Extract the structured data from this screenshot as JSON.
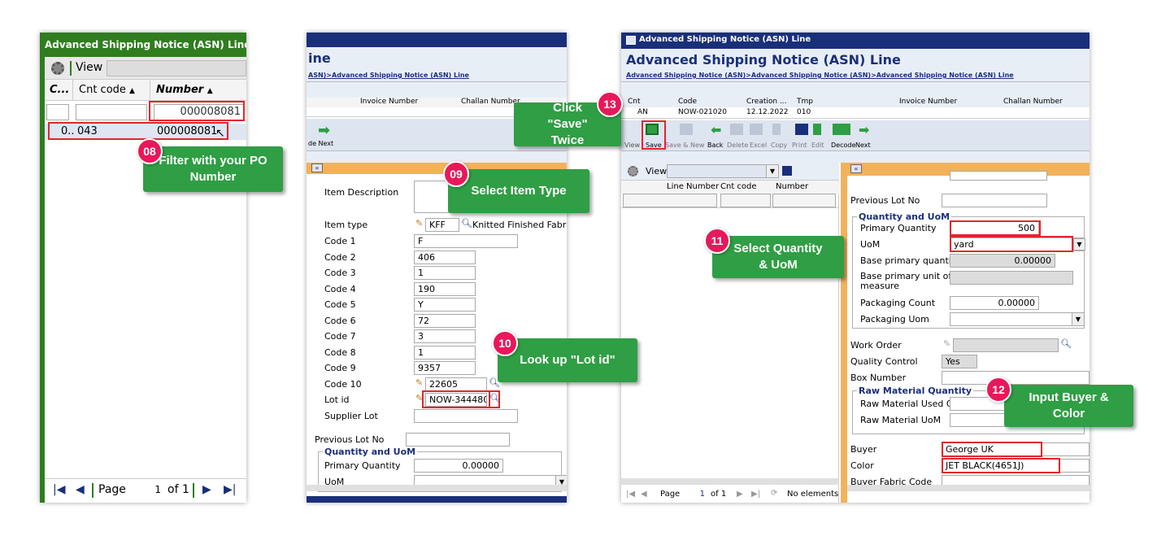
{
  "panel1": {
    "title": "Advanced Shipping Notice (ASN) Line",
    "view_label": "View",
    "col_c": "C...",
    "col_cnt_code": "Cnt code",
    "col_number": "Number",
    "filter_value": "000008081",
    "row": {
      "c": "0..",
      "cnt_code": "043",
      "number": "000008081"
    },
    "page_label": "Page",
    "page_value": "1",
    "page_of": "of 1"
  },
  "panel2": {
    "title_frag": "ine",
    "breadcrumb_frag": "ASN)>Advanced Shipping Notice (ASN) Line",
    "col_invoice": "Invoice Number",
    "col_challan": "Challan Number",
    "toolbar_frag": "de Next",
    "fields": {
      "item_description": "Item Description",
      "item_type": "Item type",
      "item_type_code": "KFF",
      "item_type_name": "Knitted Finished Fabric",
      "code1": "Code 1",
      "code1_v": "F",
      "code2": "Code 2",
      "code2_v": "406",
      "code3": "Code 3",
      "code3_v": "1",
      "code4": "Code 4",
      "code4_v": "190",
      "code5": "Code 5",
      "code5_v": "Y",
      "code6": "Code 6",
      "code6_v": "72",
      "code7": "Code 7",
      "code7_v": "3",
      "code8": "Code 8",
      "code8_v": "1",
      "code9": "Code 9",
      "code9_v": "9357",
      "code10": "Code 10",
      "code10_v": "22605",
      "lot_id": "Lot id",
      "lot_id_v": "NOW-344480",
      "supplier_lot": "Supplier Lot",
      "previous_lot": "Previous Lot No",
      "qty_group": "Quantity and UoM",
      "primary_qty": "Primary Quantity",
      "primary_qty_v": "0.00000",
      "uom": "UoM"
    }
  },
  "panel3": {
    "window_title": "Advanced Shipping Notice (ASN) Line",
    "page_title": "Advanced Shipping Notice (ASN) Line",
    "breadcrumb": "Advanced Shipping Notice (ASN)>Advanced Shipping Notice (ASN)>Advanced Shipping Notice (ASN) Line",
    "grid_headers": [
      "Cnt",
      "Code",
      "Creation ...",
      "Tmp",
      "Invoice Number",
      "Challan Number"
    ],
    "grid_row": [
      "AN",
      "NOW-021020",
      "12.12.2022",
      "010"
    ],
    "toolbar": [
      "View",
      "Save",
      "Save & New",
      "Back",
      "Delete",
      "Excel",
      "Copy",
      "Print",
      "Edit",
      "Decode",
      "Next"
    ],
    "left_view": "View",
    "left_cols": [
      "Line Number",
      "Cnt code",
      "Number"
    ],
    "pager": {
      "page": "Page",
      "value": "1",
      "of": "of 1",
      "status": "No elements"
    },
    "form": {
      "previous_lot": "Previous Lot No",
      "qty_group": "Quantity and UoM",
      "primary_qty": "Primary Quantity",
      "primary_qty_v": "500",
      "uom": "UoM",
      "uom_v": "yard",
      "base_qty": "Base primary quantity",
      "base_qty_v": "0.00000",
      "base_uom_1": "Base primary unit of",
      "base_uom_2": "measure",
      "pack_count": "Packaging Count",
      "pack_count_v": "0.00000",
      "pack_uom": "Packaging Uom",
      "work_order": "Work Order",
      "quality_control": "Quality Control",
      "quality_control_v": "Yes",
      "box_number": "Box Number",
      "raw_group": "Raw Material Quantity",
      "raw_used": "Raw Material Used Qty",
      "raw_uom": "Raw Material UoM",
      "buyer": "Buyer",
      "buyer_v": "George UK",
      "color": "Color",
      "color_v": "JET BLACK(4651J)",
      "buyer_fabric": "Buyer Fabric Code"
    }
  },
  "callouts": {
    "c08": {
      "num": "08",
      "text": "Filter with your PO Number"
    },
    "c09": {
      "num": "09",
      "text": "Select Item Type"
    },
    "c10": {
      "num": "10",
      "text": "Look up \"Lot id\""
    },
    "c11": {
      "num": "11",
      "text": "Select Quantity & UoM"
    },
    "c12": {
      "num": "12",
      "text": "Input Buyer & Color"
    },
    "c13": {
      "num": "13",
      "text": "Click \"Save\" Twice"
    }
  },
  "colors": {
    "callout_green": "#2f9e44",
    "badge_pink": "#e8185a",
    "highlight_red": "#e4242c",
    "title_green": "#2f7d1f",
    "nav_blue": "#1a2f7a",
    "section_orange": "#f2b25a"
  }
}
